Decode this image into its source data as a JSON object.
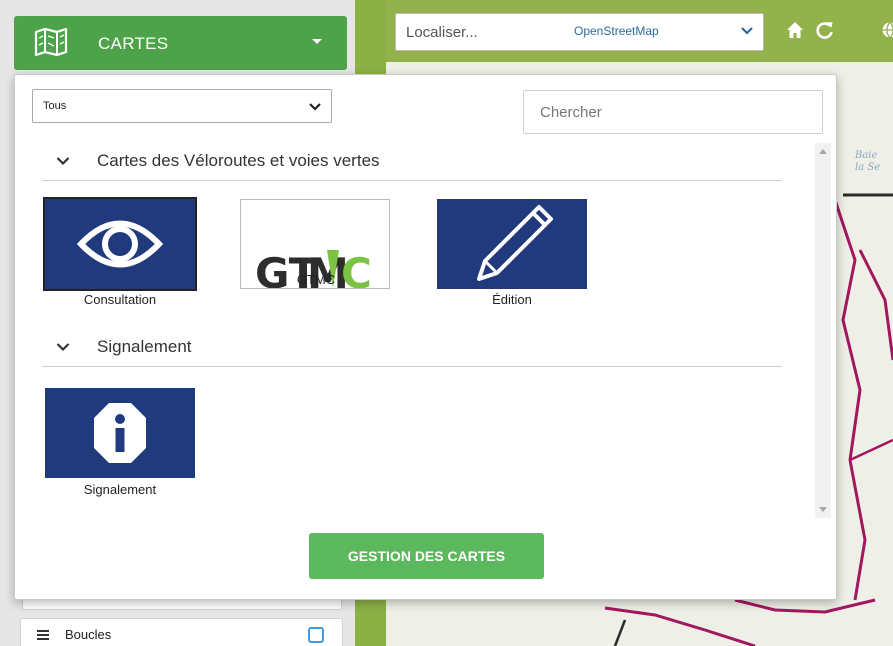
{
  "cartes_button": {
    "label": "CARTES"
  },
  "toolbar": {
    "locate_placeholder": "Localiser...",
    "base_layer": "OpenStreetMap"
  },
  "map": {
    "bay_label_1": "Baie",
    "bay_label_2": "la Se"
  },
  "panel": {
    "filter_value": "Tous",
    "search_placeholder": "Chercher",
    "categories": [
      {
        "title": "Cartes des Véloroutes et voies vertes",
        "items": [
          {
            "label": "Consultation",
            "icon": "eye-icon"
          },
          {
            "label": "GTMC",
            "icon": "gtmc-logo"
          },
          {
            "label": "Édition",
            "icon": "pencil-icon"
          }
        ]
      },
      {
        "title": "Signalement",
        "items": [
          {
            "label": "Signalement",
            "icon": "info-icon"
          }
        ]
      }
    ],
    "gestion_label": "GESTION DES CARTES"
  },
  "layers": [
    {
      "name": "Boucles"
    }
  ],
  "colors": {
    "green": "#4ea34a",
    "navy": "#213a7d",
    "route": "#a3175f",
    "button_green": "#5cb85c"
  }
}
